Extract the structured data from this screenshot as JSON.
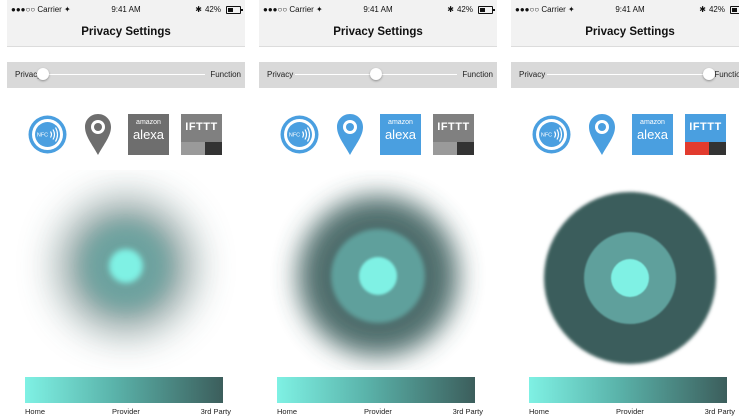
{
  "status_bar": {
    "carrier": "●●●○○ Carrier ✦",
    "time": "9:41 AM",
    "battery": "42%",
    "bluetooth_glyph": "✱"
  },
  "nav_title": "Privacy Settings",
  "slider_labels": {
    "left": "Privacy",
    "right": "Function"
  },
  "icons": {
    "alexa_brand": "amazon",
    "alexa_name": "alexa",
    "ifttt": "IFTTT",
    "nfc": "NFC"
  },
  "legend": {
    "home": "Home",
    "provider": "Provider",
    "third_party": "3rd Party"
  },
  "colors": {
    "active_blue": "#4a9fe0",
    "inactive_gray": "#6e6e6e",
    "core": "#7ff1e4",
    "provider": "#5fa09c",
    "third_party": "#3a5d5b",
    "ifttt_red": "#e23b2e"
  },
  "screens": [
    {
      "slider_position": 0.0,
      "nfc_active": true,
      "location_active": false,
      "alexa_active": false,
      "ifttt_active": false
    },
    {
      "slider_position": 0.5,
      "nfc_active": true,
      "location_active": true,
      "alexa_active": true,
      "ifttt_active": false
    },
    {
      "slider_position": 1.0,
      "nfc_active": true,
      "location_active": true,
      "alexa_active": true,
      "ifttt_active": true
    }
  ]
}
